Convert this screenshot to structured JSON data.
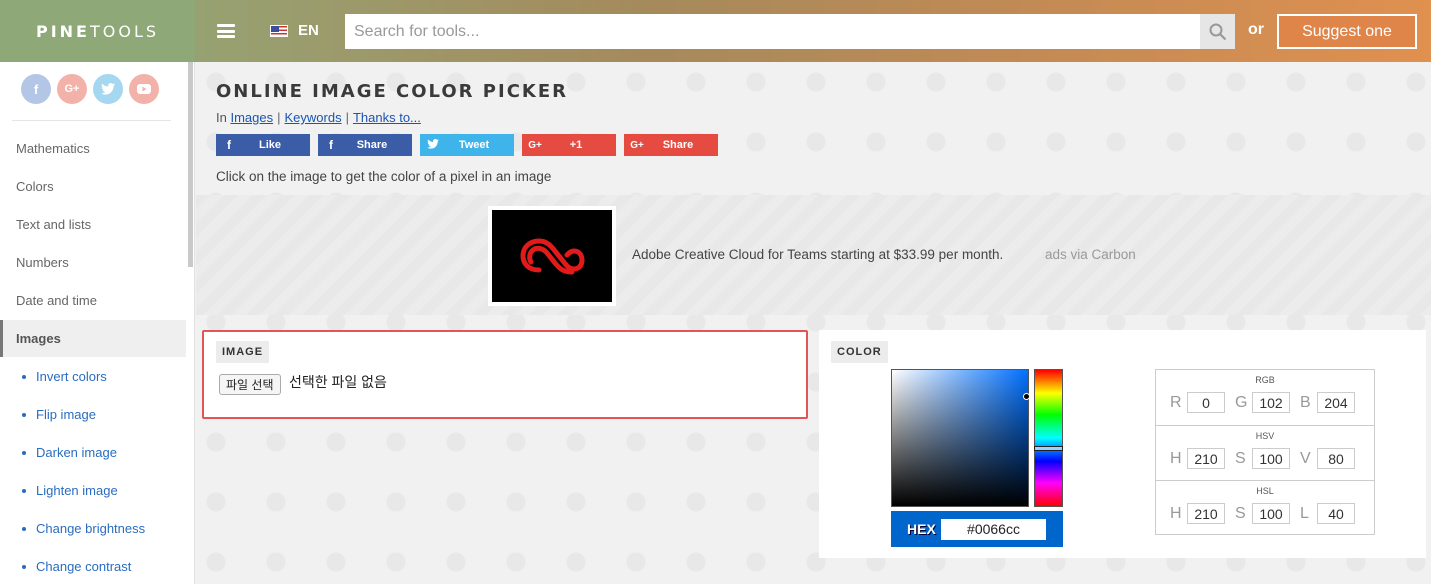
{
  "header": {
    "logo_bold": "PINE",
    "logo_light": "TOOLS",
    "language": "EN",
    "search_placeholder": "Search for tools...",
    "or_text": "or",
    "suggest_label": "Suggest one"
  },
  "sidebar": {
    "social": [
      {
        "icon": "facebook-icon",
        "glyph": "f",
        "color": "#b4c6e6"
      },
      {
        "icon": "google-plus-icon",
        "glyph": "G+",
        "color": "#f2b2aa"
      },
      {
        "icon": "twitter-icon",
        "glyph": "t",
        "color": "#a5d7f0"
      },
      {
        "icon": "youtube-icon",
        "glyph": "▶",
        "color": "#f2b2aa"
      }
    ],
    "items": [
      {
        "label": "Mathematics"
      },
      {
        "label": "Colors"
      },
      {
        "label": "Text and lists"
      },
      {
        "label": "Numbers"
      },
      {
        "label": "Date and time"
      },
      {
        "label": "Images"
      }
    ],
    "sub_items": [
      {
        "label": "Invert colors"
      },
      {
        "label": "Flip image"
      },
      {
        "label": "Darken image"
      },
      {
        "label": "Lighten image"
      },
      {
        "label": "Change brightness"
      },
      {
        "label": "Change contrast"
      }
    ]
  },
  "main": {
    "title": "ONLINE IMAGE COLOR PICKER",
    "crumbs_prefix": "In",
    "crumb_images": "Images",
    "crumb_keywords": "Keywords",
    "crumb_thanks": "Thanks to...",
    "share_buttons": [
      {
        "label": "Like",
        "glyph": "f",
        "color": "#3b5da8"
      },
      {
        "label": "Share",
        "glyph": "f",
        "color": "#3b5da8"
      },
      {
        "label": "Tweet",
        "glyph": "🐦",
        "color": "#3fb4ea"
      },
      {
        "label": "+1",
        "glyph": "G+",
        "color": "#e54b41"
      },
      {
        "label": "Share",
        "glyph": "G+",
        "color": "#e54b41"
      }
    ],
    "description": "Click on the image to get the color of a pixel in an image",
    "ad_text": "Adobe Creative Cloud for Teams starting at $33.99 per month.",
    "ad_via": "ads via Carbon"
  },
  "image_panel": {
    "label": "IMAGE",
    "file_button": "파일 선택",
    "file_status": "선택한 파일 없음"
  },
  "color_panel": {
    "label": "COLOR",
    "hex_label": "HEX",
    "hex_value": "#0066cc",
    "rgb_title": "RGB",
    "rgb": {
      "R": "0",
      "G": "102",
      "B": "204"
    },
    "hsv_title": "HSV",
    "hsv": {
      "H": "210",
      "S": "100",
      "V": "80"
    },
    "hsl_title": "HSL",
    "hsl": {
      "H": "210",
      "S": "100",
      "L": "40"
    }
  }
}
